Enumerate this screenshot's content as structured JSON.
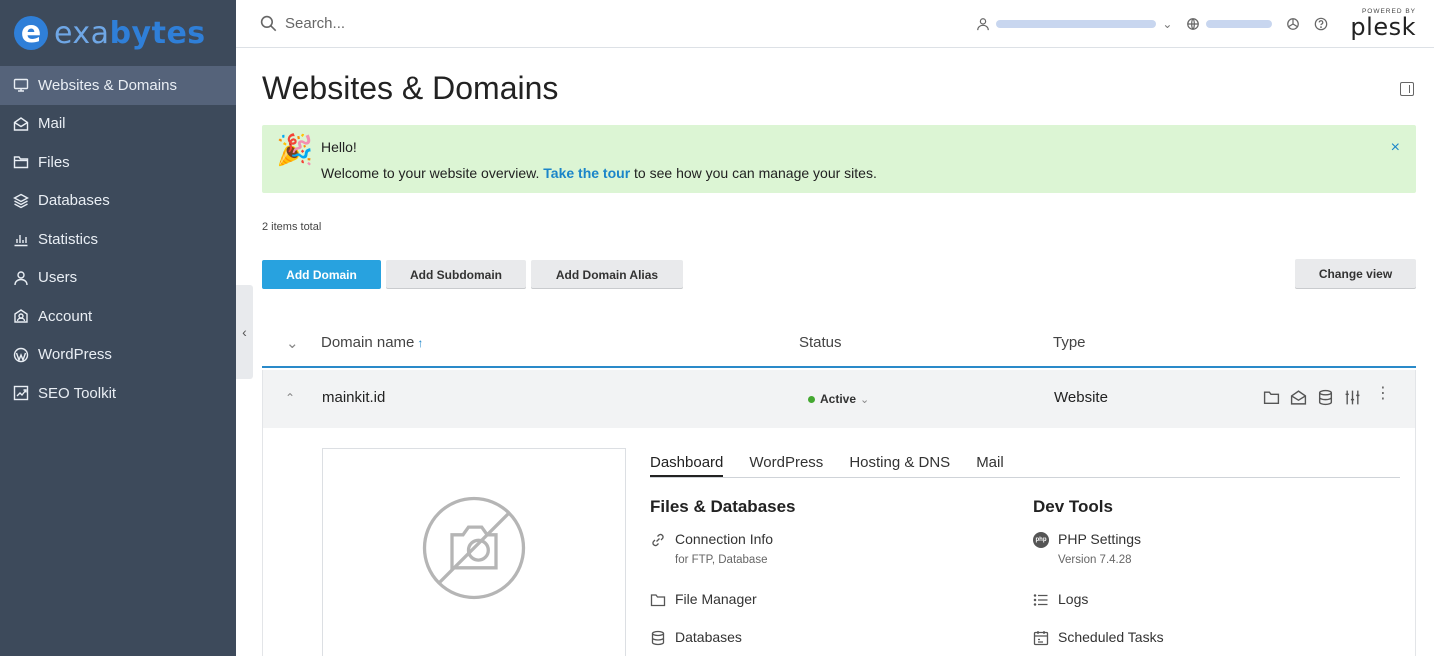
{
  "brand": {
    "logo_letter": "e",
    "name_part1": "exa",
    "name_part2": "bytes"
  },
  "sidebar": {
    "items": [
      {
        "label": "Websites & Domains",
        "icon": "monitor-icon",
        "active": true
      },
      {
        "label": "Mail",
        "icon": "mail-icon"
      },
      {
        "label": "Files",
        "icon": "folder-icon"
      },
      {
        "label": "Databases",
        "icon": "layers-icon"
      },
      {
        "label": "Statistics",
        "icon": "bar-chart-icon"
      },
      {
        "label": "Users",
        "icon": "user-icon"
      },
      {
        "label": "Account",
        "icon": "account-icon"
      },
      {
        "label": "WordPress",
        "icon": "wordpress-icon"
      },
      {
        "label": "SEO Toolkit",
        "icon": "seo-icon"
      }
    ]
  },
  "topbar": {
    "search_placeholder": "Search...",
    "plesk_powered": "POWERED BY",
    "plesk_name": "plesk"
  },
  "page": {
    "title": "Websites & Domains"
  },
  "banner": {
    "title": "Hello!",
    "text_before": "Welcome to your website overview. ",
    "link": "Take the tour",
    "text_after": " to see how you can manage your sites.",
    "close": "×"
  },
  "items_total": "2 items total",
  "toolbar": {
    "add_domain": "Add Domain",
    "add_subdomain": "Add Subdomain",
    "add_domain_alias": "Add Domain Alias",
    "change_view": "Change view"
  },
  "table": {
    "columns": {
      "domain": "Domain name",
      "status": "Status",
      "type": "Type"
    },
    "rows": [
      {
        "domain": "mainkit.id",
        "status": "Active",
        "type": "Website"
      }
    ]
  },
  "detail": {
    "tabs": [
      "Dashboard",
      "WordPress",
      "Hosting & DNS",
      "Mail"
    ],
    "files_title": "Files & Databases",
    "dev_title": "Dev Tools",
    "connection_info": "Connection Info",
    "connection_sub": "for FTP, Database",
    "file_manager": "File Manager",
    "databases": "Databases",
    "php_settings": "PHP Settings",
    "php_version": "Version 7.4.28",
    "php_badge": "php",
    "logs": "Logs",
    "scheduled_tasks": "Scheduled Tasks"
  },
  "colors": {
    "sidebar_bg": "#3d4a5b",
    "sidebar_active": "#55637a",
    "accent": "#28a2df",
    "link": "#1b85c9",
    "banner_bg": "#dcf5d4",
    "status_active": "#44a830"
  }
}
